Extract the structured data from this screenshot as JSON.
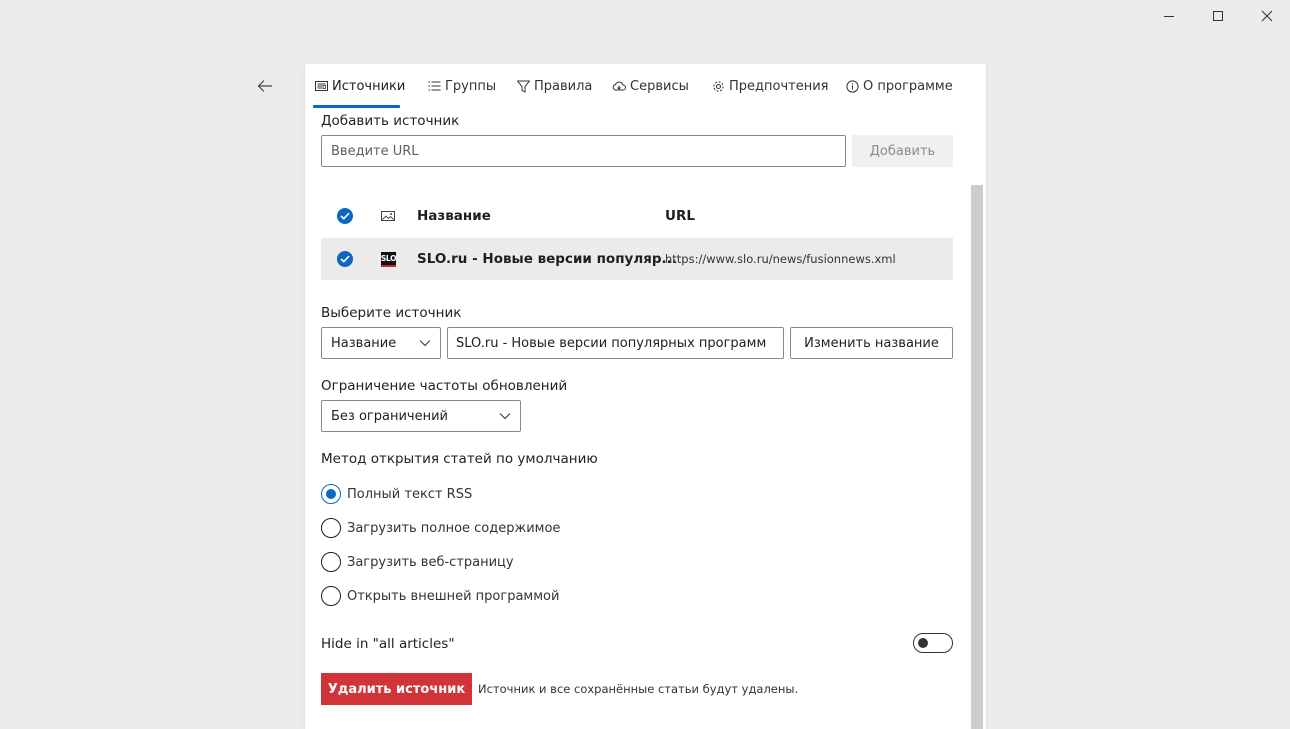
{
  "window": {
    "minimize_icon": "minimize-icon",
    "maximize_icon": "maximize-icon",
    "close_icon": "close-icon"
  },
  "nav": {
    "back_icon": "back-arrow-icon"
  },
  "tabs": [
    {
      "label": "Источники",
      "icon": "sources-icon",
      "active": true
    },
    {
      "label": "Группы",
      "icon": "list-icon"
    },
    {
      "label": "Правила",
      "icon": "filter-icon"
    },
    {
      "label": "Сервисы",
      "icon": "cloud-icon"
    },
    {
      "label": "Предпочтения",
      "icon": "gear-icon"
    },
    {
      "label": "О программе",
      "icon": "info-icon"
    }
  ],
  "add_source": {
    "label": "Добавить источник",
    "placeholder": "Введите URL",
    "value": "",
    "button": "Добавить"
  },
  "table": {
    "columns": {
      "name": "Название",
      "url": "URL"
    },
    "rows": [
      {
        "checked": true,
        "favicon_text": "SLO",
        "name": "SLO.ru - Новые версии популяр...",
        "url": "https://www.slo.ru/news/fusionnews.xml"
      }
    ]
  },
  "select_source": {
    "label": "Выберите источник",
    "field_selected": "Название",
    "value": "SLO.ru - Новые версии популярных программ",
    "rename_button": "Изменить название"
  },
  "update_limit": {
    "label": "Ограничение частоты обновлений",
    "selected": "Без ограничений"
  },
  "open_method": {
    "label": "Метод открытия статей по умолчанию",
    "options": [
      {
        "label": "Полный текст RSS",
        "selected": true
      },
      {
        "label": "Загрузить полное содержимое",
        "selected": false
      },
      {
        "label": "Загрузить веб-страницу",
        "selected": false
      },
      {
        "label": "Открыть внешней программой",
        "selected": false
      }
    ]
  },
  "hide_all": {
    "label": "Hide in \"all articles\"",
    "on": false
  },
  "delete": {
    "button": "Удалить источник",
    "note": "Источник и все сохранённые статьи будут удалены."
  },
  "colors": {
    "accent": "#0b67c2",
    "danger": "#d13438",
    "background": "#ecebea"
  }
}
